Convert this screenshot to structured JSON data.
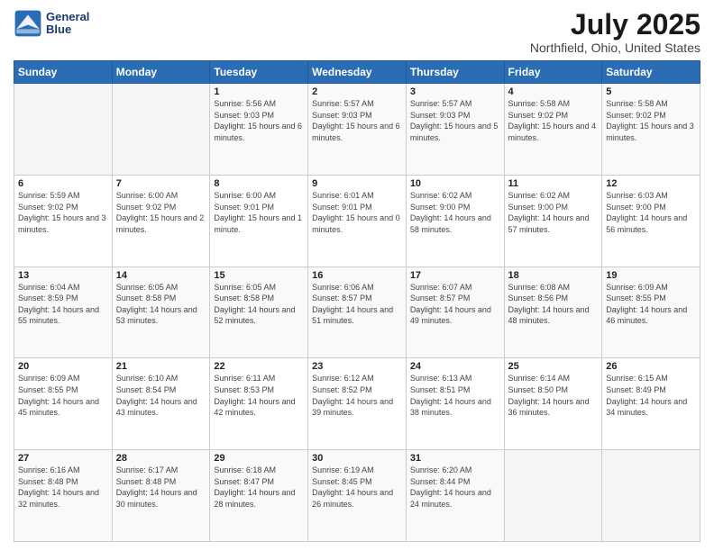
{
  "logo": {
    "line1": "General",
    "line2": "Blue"
  },
  "title": "July 2025",
  "subtitle": "Northfield, Ohio, United States",
  "weekdays": [
    "Sunday",
    "Monday",
    "Tuesday",
    "Wednesday",
    "Thursday",
    "Friday",
    "Saturday"
  ],
  "weeks": [
    [
      {
        "day": "",
        "sunrise": "",
        "sunset": "",
        "daylight": ""
      },
      {
        "day": "",
        "sunrise": "",
        "sunset": "",
        "daylight": ""
      },
      {
        "day": "1",
        "sunrise": "Sunrise: 5:56 AM",
        "sunset": "Sunset: 9:03 PM",
        "daylight": "Daylight: 15 hours and 6 minutes."
      },
      {
        "day": "2",
        "sunrise": "Sunrise: 5:57 AM",
        "sunset": "Sunset: 9:03 PM",
        "daylight": "Daylight: 15 hours and 6 minutes."
      },
      {
        "day": "3",
        "sunrise": "Sunrise: 5:57 AM",
        "sunset": "Sunset: 9:03 PM",
        "daylight": "Daylight: 15 hours and 5 minutes."
      },
      {
        "day": "4",
        "sunrise": "Sunrise: 5:58 AM",
        "sunset": "Sunset: 9:02 PM",
        "daylight": "Daylight: 15 hours and 4 minutes."
      },
      {
        "day": "5",
        "sunrise": "Sunrise: 5:58 AM",
        "sunset": "Sunset: 9:02 PM",
        "daylight": "Daylight: 15 hours and 3 minutes."
      }
    ],
    [
      {
        "day": "6",
        "sunrise": "Sunrise: 5:59 AM",
        "sunset": "Sunset: 9:02 PM",
        "daylight": "Daylight: 15 hours and 3 minutes."
      },
      {
        "day": "7",
        "sunrise": "Sunrise: 6:00 AM",
        "sunset": "Sunset: 9:02 PM",
        "daylight": "Daylight: 15 hours and 2 minutes."
      },
      {
        "day": "8",
        "sunrise": "Sunrise: 6:00 AM",
        "sunset": "Sunset: 9:01 PM",
        "daylight": "Daylight: 15 hours and 1 minute."
      },
      {
        "day": "9",
        "sunrise": "Sunrise: 6:01 AM",
        "sunset": "Sunset: 9:01 PM",
        "daylight": "Daylight: 15 hours and 0 minutes."
      },
      {
        "day": "10",
        "sunrise": "Sunrise: 6:02 AM",
        "sunset": "Sunset: 9:00 PM",
        "daylight": "Daylight: 14 hours and 58 minutes."
      },
      {
        "day": "11",
        "sunrise": "Sunrise: 6:02 AM",
        "sunset": "Sunset: 9:00 PM",
        "daylight": "Daylight: 14 hours and 57 minutes."
      },
      {
        "day": "12",
        "sunrise": "Sunrise: 6:03 AM",
        "sunset": "Sunset: 9:00 PM",
        "daylight": "Daylight: 14 hours and 56 minutes."
      }
    ],
    [
      {
        "day": "13",
        "sunrise": "Sunrise: 6:04 AM",
        "sunset": "Sunset: 8:59 PM",
        "daylight": "Daylight: 14 hours and 55 minutes."
      },
      {
        "day": "14",
        "sunrise": "Sunrise: 6:05 AM",
        "sunset": "Sunset: 8:58 PM",
        "daylight": "Daylight: 14 hours and 53 minutes."
      },
      {
        "day": "15",
        "sunrise": "Sunrise: 6:05 AM",
        "sunset": "Sunset: 8:58 PM",
        "daylight": "Daylight: 14 hours and 52 minutes."
      },
      {
        "day": "16",
        "sunrise": "Sunrise: 6:06 AM",
        "sunset": "Sunset: 8:57 PM",
        "daylight": "Daylight: 14 hours and 51 minutes."
      },
      {
        "day": "17",
        "sunrise": "Sunrise: 6:07 AM",
        "sunset": "Sunset: 8:57 PM",
        "daylight": "Daylight: 14 hours and 49 minutes."
      },
      {
        "day": "18",
        "sunrise": "Sunrise: 6:08 AM",
        "sunset": "Sunset: 8:56 PM",
        "daylight": "Daylight: 14 hours and 48 minutes."
      },
      {
        "day": "19",
        "sunrise": "Sunrise: 6:09 AM",
        "sunset": "Sunset: 8:55 PM",
        "daylight": "Daylight: 14 hours and 46 minutes."
      }
    ],
    [
      {
        "day": "20",
        "sunrise": "Sunrise: 6:09 AM",
        "sunset": "Sunset: 8:55 PM",
        "daylight": "Daylight: 14 hours and 45 minutes."
      },
      {
        "day": "21",
        "sunrise": "Sunrise: 6:10 AM",
        "sunset": "Sunset: 8:54 PM",
        "daylight": "Daylight: 14 hours and 43 minutes."
      },
      {
        "day": "22",
        "sunrise": "Sunrise: 6:11 AM",
        "sunset": "Sunset: 8:53 PM",
        "daylight": "Daylight: 14 hours and 42 minutes."
      },
      {
        "day": "23",
        "sunrise": "Sunrise: 6:12 AM",
        "sunset": "Sunset: 8:52 PM",
        "daylight": "Daylight: 14 hours and 39 minutes."
      },
      {
        "day": "24",
        "sunrise": "Sunrise: 6:13 AM",
        "sunset": "Sunset: 8:51 PM",
        "daylight": "Daylight: 14 hours and 38 minutes."
      },
      {
        "day": "25",
        "sunrise": "Sunrise: 6:14 AM",
        "sunset": "Sunset: 8:50 PM",
        "daylight": "Daylight: 14 hours and 36 minutes."
      },
      {
        "day": "26",
        "sunrise": "Sunrise: 6:15 AM",
        "sunset": "Sunset: 8:49 PM",
        "daylight": "Daylight: 14 hours and 34 minutes."
      }
    ],
    [
      {
        "day": "27",
        "sunrise": "Sunrise: 6:16 AM",
        "sunset": "Sunset: 8:48 PM",
        "daylight": "Daylight: 14 hours and 32 minutes."
      },
      {
        "day": "28",
        "sunrise": "Sunrise: 6:17 AM",
        "sunset": "Sunset: 8:48 PM",
        "daylight": "Daylight: 14 hours and 30 minutes."
      },
      {
        "day": "29",
        "sunrise": "Sunrise: 6:18 AM",
        "sunset": "Sunset: 8:47 PM",
        "daylight": "Daylight: 14 hours and 28 minutes."
      },
      {
        "day": "30",
        "sunrise": "Sunrise: 6:19 AM",
        "sunset": "Sunset: 8:45 PM",
        "daylight": "Daylight: 14 hours and 26 minutes."
      },
      {
        "day": "31",
        "sunrise": "Sunrise: 6:20 AM",
        "sunset": "Sunset: 8:44 PM",
        "daylight": "Daylight: 14 hours and 24 minutes."
      },
      {
        "day": "",
        "sunrise": "",
        "sunset": "",
        "daylight": ""
      },
      {
        "day": "",
        "sunrise": "",
        "sunset": "",
        "daylight": ""
      }
    ]
  ]
}
